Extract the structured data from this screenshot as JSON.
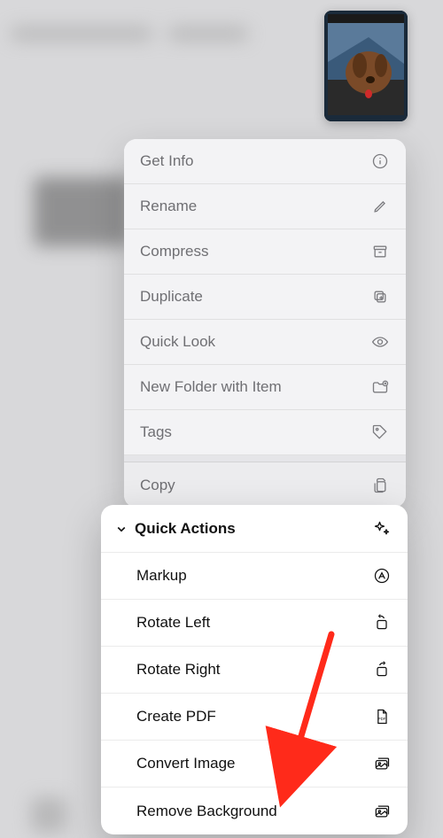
{
  "thumbnail": {
    "description": "dog-in-car-window"
  },
  "menu": {
    "items": [
      {
        "label": "Get Info",
        "icon": "info-icon"
      },
      {
        "label": "Rename",
        "icon": "pencil-icon"
      },
      {
        "label": "Compress",
        "icon": "archive-icon"
      },
      {
        "label": "Duplicate",
        "icon": "duplicate-icon"
      },
      {
        "label": "Quick Look",
        "icon": "eye-icon"
      },
      {
        "label": "New Folder with Item",
        "icon": "folder-plus-icon"
      },
      {
        "label": "Tags",
        "icon": "tag-icon"
      }
    ],
    "copy_label": "Copy"
  },
  "quick_actions": {
    "header": "Quick Actions",
    "items": [
      {
        "label": "Markup",
        "icon": "markup-icon"
      },
      {
        "label": "Rotate Left",
        "icon": "rotate-left-icon"
      },
      {
        "label": "Rotate Right",
        "icon": "rotate-right-icon"
      },
      {
        "label": "Create PDF",
        "icon": "pdf-icon"
      },
      {
        "label": "Convert Image",
        "icon": "image-stack-icon"
      },
      {
        "label": "Remove Background",
        "icon": "image-stack-icon"
      }
    ]
  },
  "annotation": {
    "arrow_color": "#ff2a1a"
  }
}
